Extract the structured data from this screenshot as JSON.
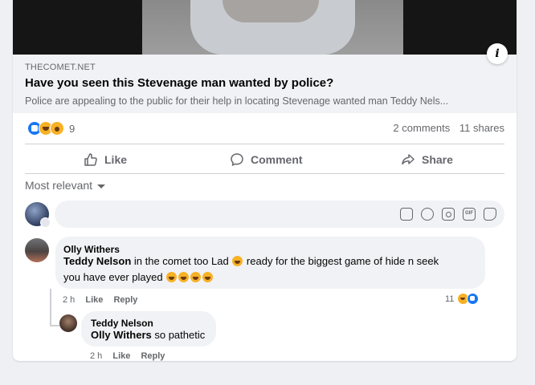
{
  "link_preview": {
    "domain": "THECOMET.NET",
    "headline": "Have you seen this Stevenage man wanted by police?",
    "description": "Police are appealing to the public for their help in locating Stevenage wanted man Teddy Nels..."
  },
  "stats": {
    "reaction_count": "9",
    "comments": "2 comments",
    "shares": "11 shares",
    "reaction_icons": [
      "like-icon",
      "haha-icon",
      "wow-icon"
    ]
  },
  "actions": {
    "like": "Like",
    "comment": "Comment",
    "share": "Share"
  },
  "sort_label": "Most relevant",
  "comments": [
    {
      "author": "Olly Withers",
      "mention": "Teddy Nelson",
      "text_1": " in the comet too Lad ",
      "text_2": " ready for the biggest game of hide n seek",
      "text_3": "you have ever played ",
      "time": "2 h",
      "like": "Like",
      "reply": "Reply",
      "reactions": "11"
    },
    {
      "author": "Teddy Nelson",
      "mention": "Olly Withers",
      "text": " so pathetic",
      "time": "2 h",
      "like": "Like",
      "reply": "Reply"
    }
  ],
  "colors": {
    "accent": "#1877f2",
    "secondary_text": "#65676b",
    "bubble_bg": "#f0f2f5"
  }
}
